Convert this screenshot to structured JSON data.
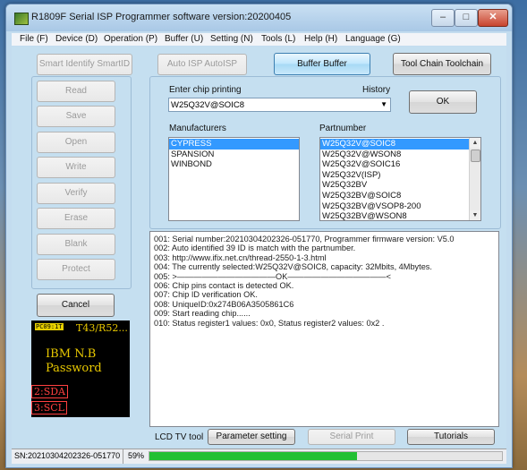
{
  "window": {
    "title": "R1809F Serial ISP Programmer software version:20200405",
    "controls": {
      "minimize": "–",
      "maximize": "□",
      "close": "✕"
    }
  },
  "menu": [
    "File (F)",
    "Device (D)",
    "Operation (P)",
    "Buffer (U)",
    "Setting (N)",
    "Tools (L)",
    "Help (H)",
    "Language (G)"
  ],
  "toolbar": {
    "smart_identify": "Smart Identify SmartID",
    "auto_isp": "Auto ISP AutoISP",
    "buffer": "Buffer Buffer",
    "tool_chain": "Tool Chain Toolchain"
  },
  "operations": [
    "Read",
    "Save",
    "Open",
    "Write",
    "Verify",
    "Erase",
    "Blank",
    "Protect"
  ],
  "cancel_label": "Cancel",
  "chip": {
    "enter_label": "Enter chip printing",
    "history_label": "History",
    "value": "W25Q32V@SOIC8",
    "ok_label": "OK"
  },
  "manufacturers": {
    "label": "Manufacturers",
    "items": [
      "CYPRESS",
      "SPANSION",
      "WINBOND"
    ],
    "selected": 0
  },
  "partnumber": {
    "label": "Partnumber",
    "items": [
      "W25Q32V@SOIC8",
      "W25Q32V@WSON8",
      "W25Q32V@SOIC16",
      "W25Q32V(ISP)",
      "W25Q32BV",
      "W25Q32BV@SOIC8",
      "W25Q32BV@VSOP8-200",
      "W25Q32BV@WSON8"
    ],
    "selected": 0
  },
  "log": [
    "001:  Serial number:20210304202326-051770, Programmer firmware version: V5.0",
    "002:  Auto identified 39 ID is match with the partnumber.",
    "003:  http://www.ifix.net.cn/thread-2550-1-3.html",
    "004:  The currently selected:W25Q32V@SOIC8, capacity: 32Mbits, 4Mbytes.",
    "005:  >————————————OK————————————<",
    "006:  Chip pins contact is detected OK.",
    "007:  Chip ID verification OK.",
    "008:  UniqueID:0x274B06A3505861C6",
    "009:  Start reading chip......",
    "010:  Status register1 values: 0x0, Status register2 values: 0x2 ."
  ],
  "preview": {
    "tag": "PC09:1T",
    "header": "T43/R52...",
    "line1": "IBM  N.B",
    "line2": "Password",
    "pin1": "2:SDA",
    "pin2": "3:SCL"
  },
  "bottom": {
    "lcd_label": "LCD TV tool",
    "parameter_setting": "Parameter setting",
    "serial_print": "Serial Print",
    "tutorials": "Tutorials"
  },
  "status": {
    "serial": "SN:20210304202326-051770",
    "percent_text": "59%",
    "progress": 0.59,
    "progress_color": "#22c033"
  }
}
